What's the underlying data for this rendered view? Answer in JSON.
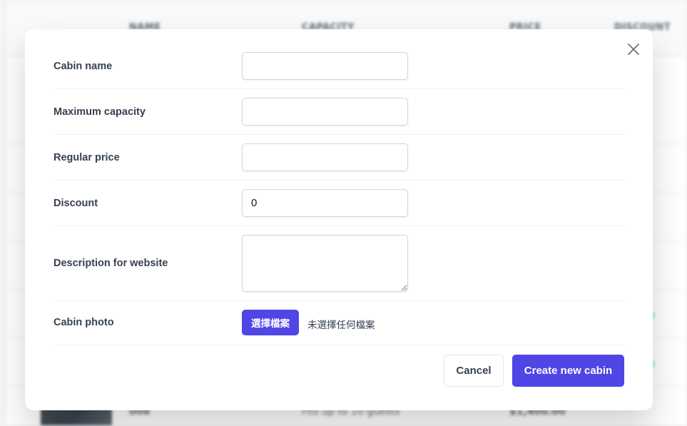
{
  "background_table": {
    "headers": [
      "name",
      "capacity",
      "price",
      "discount"
    ],
    "last_row": {
      "name": "008",
      "capacity": "Fits up to 10 guests",
      "price": "$1,400.00"
    }
  },
  "modal": {
    "close_icon": "close-icon",
    "fields": [
      {
        "label": "Cabin name",
        "value": "",
        "placeholder": ""
      },
      {
        "label": "Maximum capacity",
        "value": "",
        "placeholder": ""
      },
      {
        "label": "Regular price",
        "value": "",
        "placeholder": ""
      },
      {
        "label": "Discount",
        "value": "0",
        "placeholder": ""
      },
      {
        "label": "Description for website",
        "value": "",
        "placeholder": ""
      }
    ],
    "photo": {
      "label": "Cabin photo",
      "button_label": "選擇檔案",
      "status": "未選擇任何檔案"
    },
    "cancel_label": "Cancel",
    "submit_label": "Create new cabin"
  },
  "colors": {
    "accent": "#4f46e5",
    "text": "#374151",
    "border": "#d1d5db"
  }
}
